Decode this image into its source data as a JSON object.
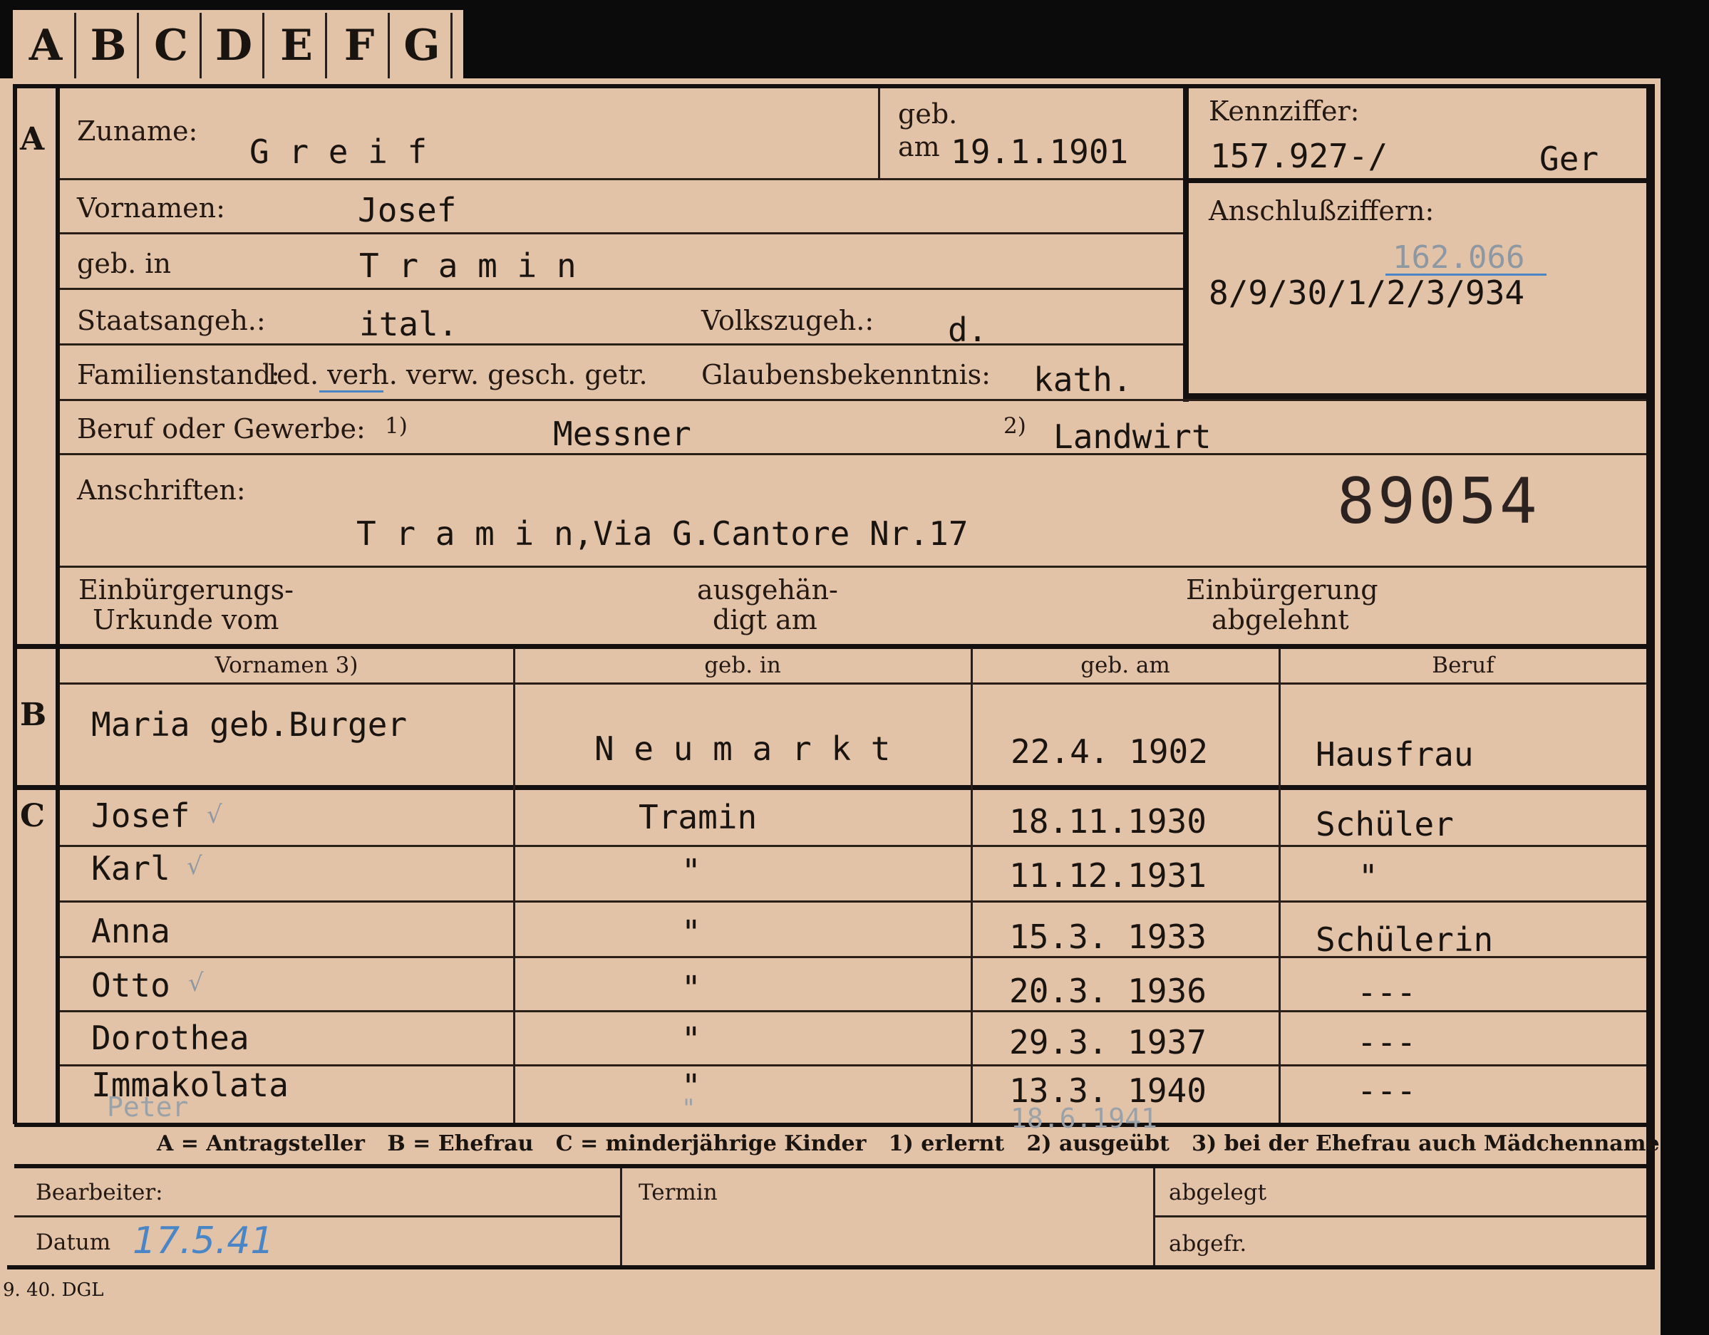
{
  "tabs": [
    "A",
    "B",
    "C",
    "D",
    "E",
    "F",
    "G"
  ],
  "sections": {
    "a": "A",
    "b": "B",
    "c": "C"
  },
  "section_a": {
    "zuname_label": "Zuname:",
    "zuname": "G r e i f",
    "geb_label": "geb.",
    "am_label": "am",
    "geb_am": "19.1.1901",
    "kennziffer_label": "Kennziffer:",
    "kennziffer": "157.927-/",
    "kennziffer_suffix": "Ger",
    "anschluss_label": "Anschlußziffern:",
    "anschluss_handwritten": "162.066",
    "anschluss_value": "8/9/30/1/2/3/934",
    "vornamen_label": "Vornamen:",
    "vornamen": "Josef",
    "gebin_label": "geb. in",
    "gebin": "T r a m i n",
    "staat_label": "Staatsangeh.:",
    "staat": "ital.",
    "volk_label": "Volkszugeh.:",
    "volk": "d.",
    "familien_label": "Familienstand:",
    "familien_options": "led. verh. verw. gesch. getr.",
    "glaube_label": "Glaubensbekenntnis:",
    "glaube": "kath.",
    "beruf_label": "Beruf oder Gewerbe:",
    "beruf_note1": "1)",
    "beruf1": "Messner",
    "beruf_note2": "2)",
    "beruf2": "Landwirt",
    "anschriften_label": "Anschriften:",
    "anschrift": "T r a m i n,Via G.Cantore Nr.17",
    "stamp_number": "89054",
    "einb_urkunde_label_1": "Einbürgerungs-",
    "einb_urkunde_label_2": "Urkunde vom",
    "ausgehaendigt_label_1": "ausgehän-",
    "ausgehaendigt_label_2": "digt am",
    "einb_abgelehnt_label_1": "Einbürgerung",
    "einb_abgelehnt_label_2": "abgelehnt"
  },
  "table_headers": [
    "Vornamen 3)",
    "geb. in",
    "geb. am",
    "Beruf"
  ],
  "spouse": {
    "vorname": "Maria geb.Burger",
    "gebin": "N e u m a r k t",
    "gebam": "22.4. 1902",
    "beruf": "Hausfrau"
  },
  "children": [
    {
      "vorname": "Josef",
      "check": "√",
      "gebin": "Tramin",
      "gebam": "18.11.1930",
      "beruf": "Schüler"
    },
    {
      "vorname": "Karl",
      "check": "√",
      "gebin": "\"",
      "gebam": "11.12.1931",
      "beruf": "\""
    },
    {
      "vorname": "Anna",
      "check": "",
      "gebin": "\"",
      "gebam": "15.3. 1933",
      "beruf": "Schülerin"
    },
    {
      "vorname": "Otto",
      "check": "√",
      "gebin": "\"",
      "gebam": "20.3. 1936",
      "beruf": "---"
    },
    {
      "vorname": "Dorothea",
      "check": "",
      "gebin": "\"",
      "gebam": "29.3. 1937",
      "beruf": "---"
    },
    {
      "vorname": "Immakolata",
      "check": "",
      "gebin": "\"",
      "gebam": "13.3. 1940",
      "beruf": "---"
    }
  ],
  "extra_child": {
    "vorname": "Peter",
    "gebin": "\"",
    "gebam": "18.6.1941"
  },
  "legend": "A = Antragsteller   B = Ehefrau   C = minderjährige Kinder   1) erlernt   2) ausgeübt   3) bei der Ehefrau auch Mädchenname",
  "footer": {
    "bearbeiter_label": "Bearbeiter:",
    "datum_label": "Datum",
    "datum_value": "17.5.41",
    "termin_label": "Termin",
    "abgelegt_label": "abgelegt",
    "abgefr_label": "abgefr."
  },
  "print_code": "9. 40. DGL",
  "colors": {
    "card": "#e3c3a8",
    "ink": "#1a1410",
    "handwriting_blue": "#4a86c6",
    "pencil": "#8a9aa8"
  }
}
